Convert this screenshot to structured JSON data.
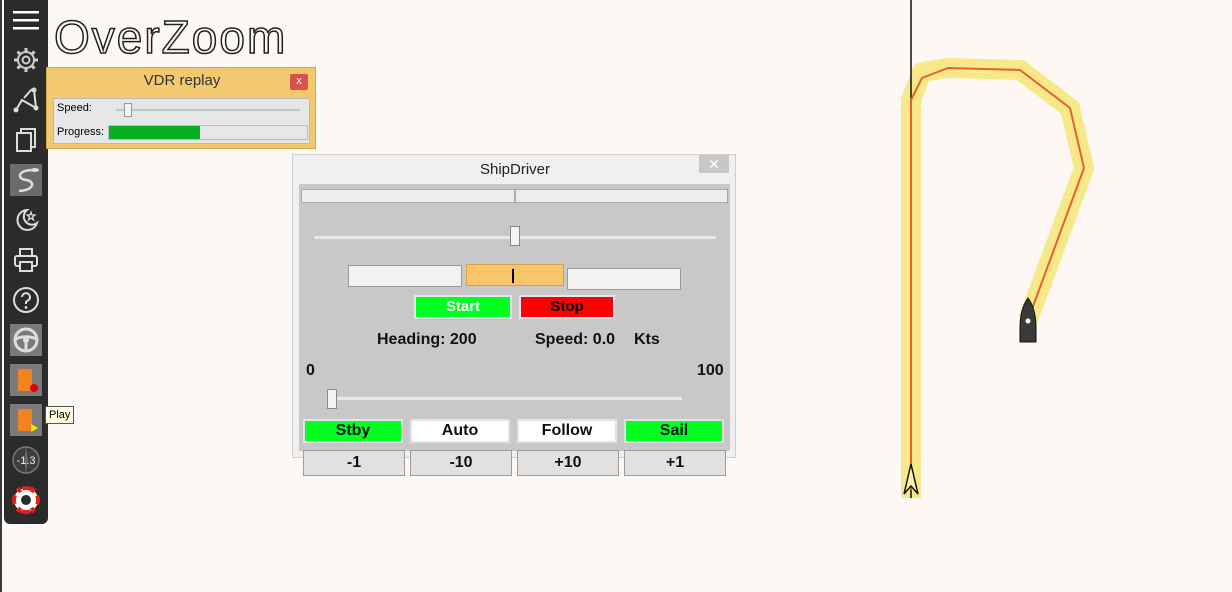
{
  "watermark": "OverZoom",
  "toolbar": {
    "items": [
      {
        "icon": "hamburger-menu-icon"
      },
      {
        "icon": "gear-icon"
      },
      {
        "icon": "route-icon"
      },
      {
        "icon": "documents-icon"
      },
      {
        "icon": "track-icon"
      },
      {
        "icon": "moon-star-icon"
      },
      {
        "icon": "printer-icon"
      },
      {
        "icon": "help-icon"
      },
      {
        "icon": "steering-wheel-icon"
      },
      {
        "icon": "vdr-record-icon"
      },
      {
        "icon": "vdr-play-icon"
      },
      {
        "icon": "compass-icon",
        "label": "-1.3"
      },
      {
        "icon": "lifebuoy-icon"
      }
    ],
    "tooltip": "Play"
  },
  "vdr": {
    "title": "VDR replay",
    "close": "x",
    "speed_label": "Speed:",
    "progress_label": "Progress:",
    "progress_fraction": 0.46
  },
  "shipdriver": {
    "title": "ShipDriver",
    "close": "✕",
    "start_label": "Start",
    "stop_label": "Stop",
    "heading_text": "Heading:  200",
    "speed_text": "Speed: 0.0",
    "speed_unit": "Kts",
    "gain_min": "0",
    "gain_max": "100",
    "modes": [
      "Stby",
      "Auto",
      "Follow",
      "Sail"
    ],
    "steps": [
      "-1",
      "-10",
      "+10",
      "+1"
    ]
  },
  "colors": {
    "toolbar_bg": "#2b2b2b",
    "vdr_bg": "#f2c96e",
    "progress_green": "#06b025",
    "start_green": "#00ff22",
    "stop_red": "#ff0000",
    "track_halo": "#f7e98a",
    "track_line": "#e8602c"
  }
}
